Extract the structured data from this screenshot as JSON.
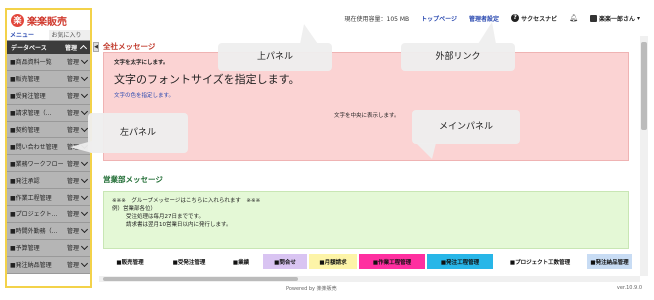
{
  "topbar": {
    "usage": "現在使用容量：105 MB",
    "top_page": "トップページ",
    "admin_settings": "管理者設定",
    "success_navi": "サクセスナビ",
    "user": "楽楽一郎さん"
  },
  "sidebar": {
    "logo_mark": "楽",
    "logo_text": "楽楽販売",
    "tabs": [
      "メニュー",
      "お気に入り"
    ],
    "db_header": {
      "label": "データベース",
      "kanri": "管理"
    },
    "items": [
      {
        "label": "■商品資料一覧",
        "kanri": "管理"
      },
      {
        "label": "■販売管理",
        "kanri": "管理"
      },
      {
        "label": "■受発注管理",
        "kanri": "管理"
      },
      {
        "label": "■請求管理（…",
        "kanri": "管理"
      },
      {
        "label": "■契約管理",
        "kanri": "管理"
      },
      {
        "label": "■問い合わせ管理",
        "kanri": "管理"
      },
      {
        "label": "■業務ワークフロー",
        "kanri": "管理"
      },
      {
        "label": "■発注承認",
        "kanri": "管理"
      },
      {
        "label": "■作業工程管理",
        "kanri": "管理"
      },
      {
        "label": "■プロジェクト…",
        "kanri": "管理"
      },
      {
        "label": "■時間外勤務（…",
        "kanri": "管理"
      },
      {
        "label": "■予算管理",
        "kanri": "管理"
      },
      {
        "label": "■発注納品管理",
        "kanri": "管理"
      }
    ]
  },
  "main": {
    "company_title": "全社メッセージ",
    "company_msg": {
      "small": "文字を太字にします。",
      "big": "文字のフォントサイズを指定します。",
      "color": "文字の色を指定します。",
      "center": "文字を中央に表示します。"
    },
    "sales_title": "営業部メッセージ",
    "sales_msg": [
      "※※※　グループメッセージはこちらに入れられます　※※※",
      "例）営業部各位）",
      "受注処理は毎月27日までです。",
      "請求書は翌月10営業日以内に発行します。"
    ]
  },
  "bottomnav": [
    {
      "label": "■販売管理",
      "color": "#ffffff"
    },
    {
      "label": "■受発注管理",
      "color": "#ffffff"
    },
    {
      "label": "■業績",
      "color": "#ffffff"
    },
    {
      "label": "■問合せ",
      "color": "#d9c4f2"
    },
    {
      "label": "■月額請求",
      "color": "#fdf4a8"
    },
    {
      "label": "■作業工程管理",
      "color": "#ff2fa0"
    },
    {
      "label": "■発注工程管理",
      "color": "#28b6e8"
    },
    {
      "label": "■プロジェクト工数管理",
      "color": "#ffffff"
    },
    {
      "label": "■発注納品管理",
      "color": "#c8dcf4"
    }
  ],
  "footer": {
    "powered": "Powered by 楽楽販売",
    "version": "ver.10.9.0"
  },
  "annotations": {
    "top": "上パネル",
    "external": "外部リンク",
    "left": "左パネル",
    "main": "メインパネル"
  },
  "colors": {
    "accent_red": "#c0392b",
    "link_blue": "#2a49b0",
    "highlight_yellow": "#f3d24a",
    "pink_box": "#fbd3d3",
    "green_box": "#e4f8d6"
  }
}
